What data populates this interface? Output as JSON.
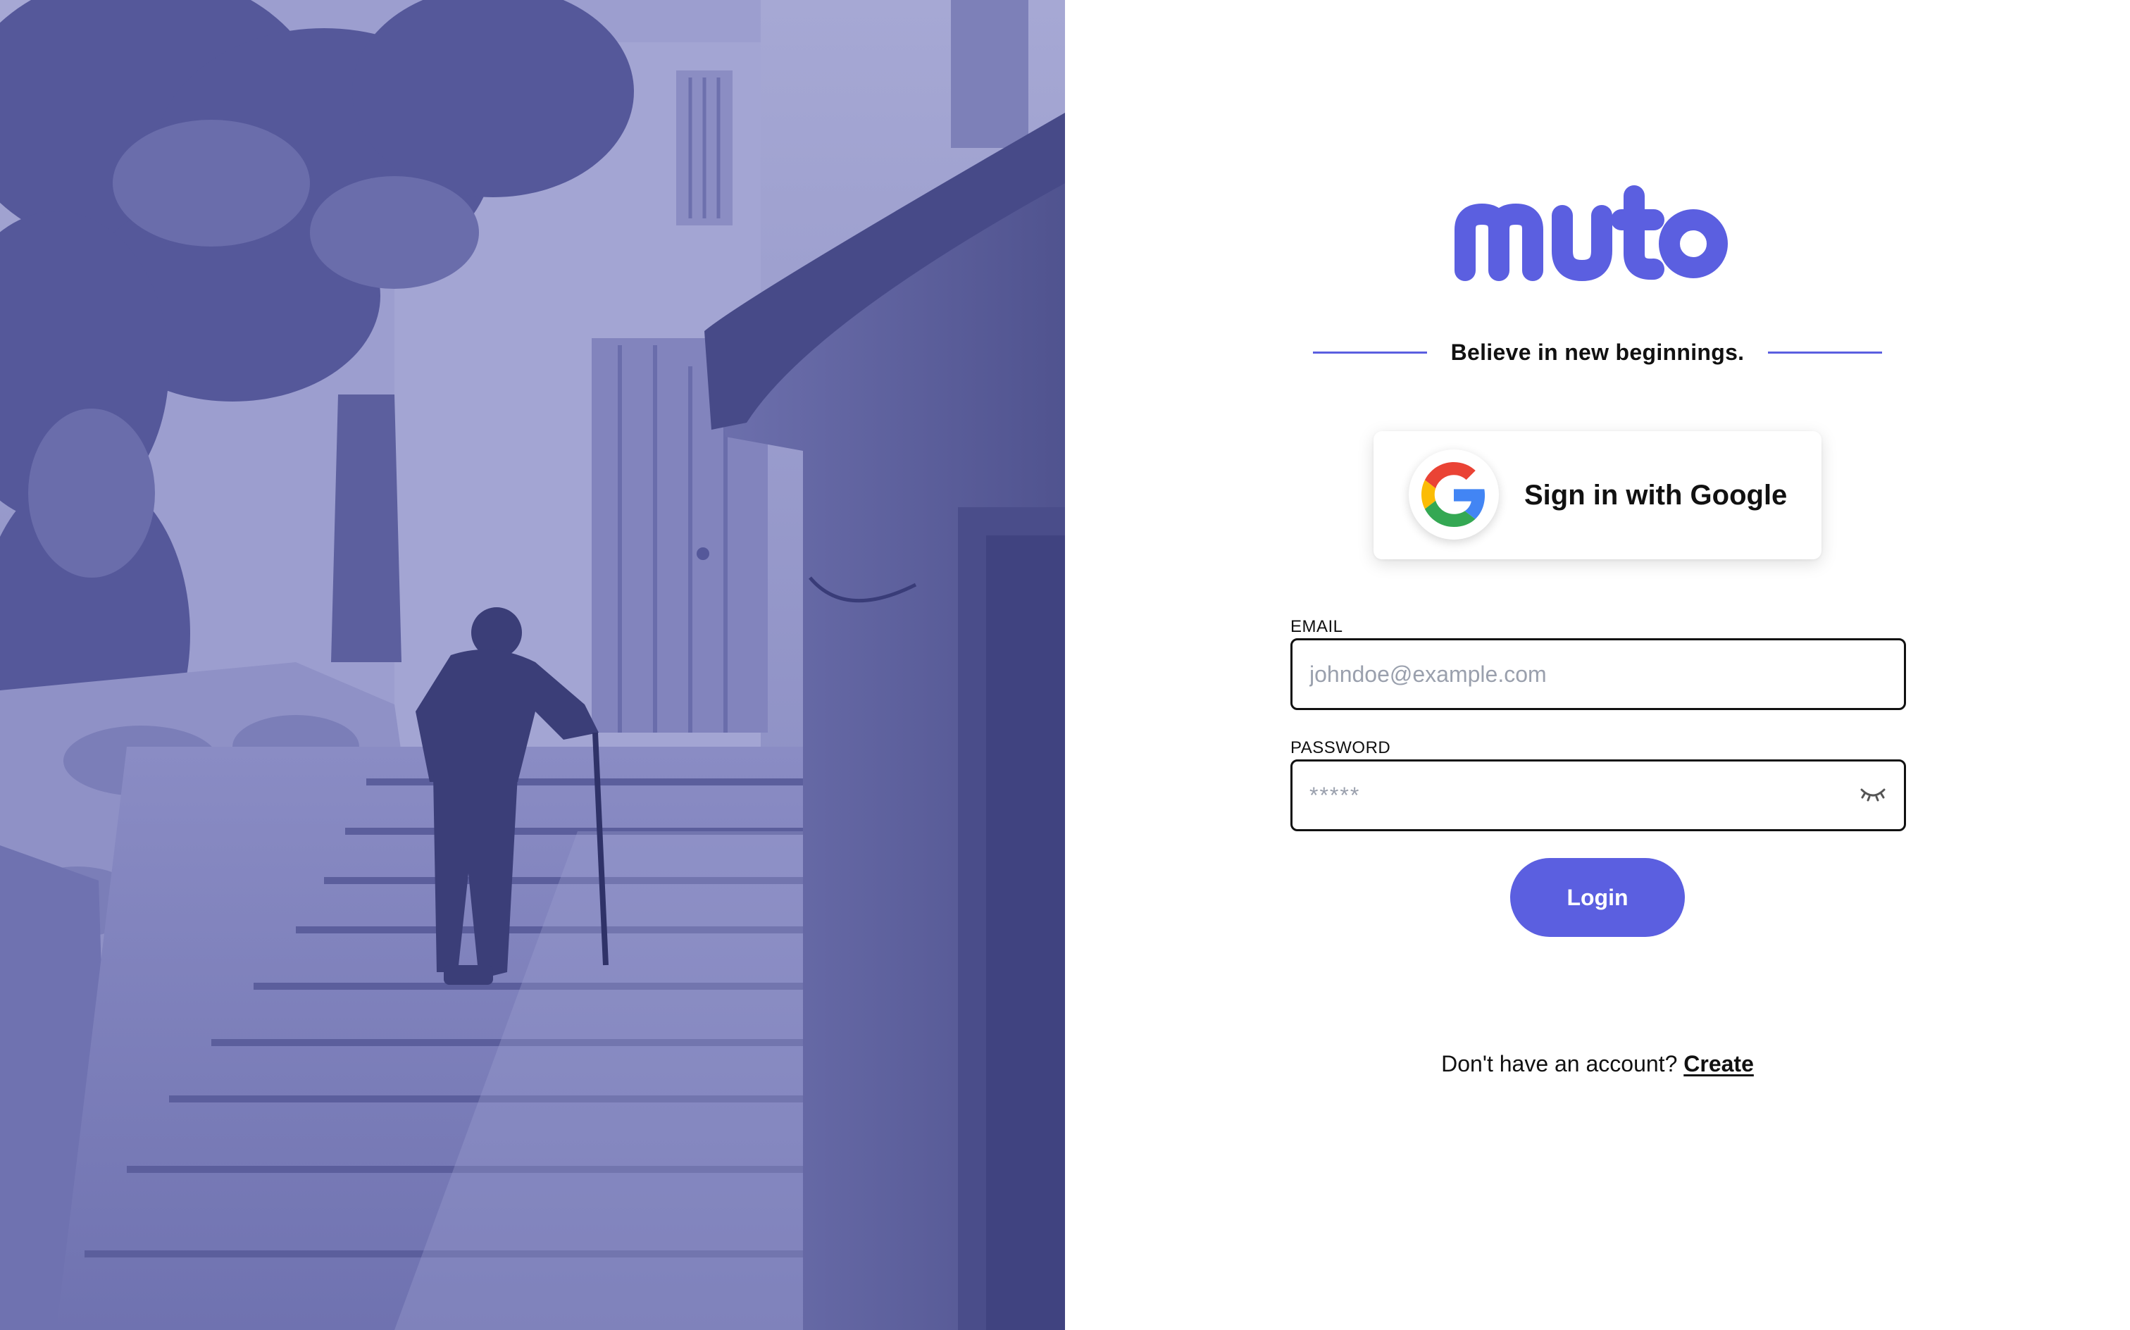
{
  "brand": {
    "name": "muto",
    "accent_color": "#5b5fe0",
    "tagline": "Believe in new beginnings."
  },
  "hero_image": {
    "subject": "old man with cane climbing stone stairs",
    "tint_color": "#6366c0"
  },
  "google_signin": {
    "label": "Sign in with Google",
    "icon": "google-g-icon"
  },
  "form": {
    "email": {
      "label": "EMAIL",
      "placeholder": "johndoe@example.com",
      "value": ""
    },
    "password": {
      "label": "PASSWORD",
      "placeholder": "*****",
      "value": "",
      "toggle_icon": "eye-closed-icon"
    },
    "login_label": "Login"
  },
  "signup": {
    "prompt": "Don't have an account?",
    "link_label": "Create"
  }
}
